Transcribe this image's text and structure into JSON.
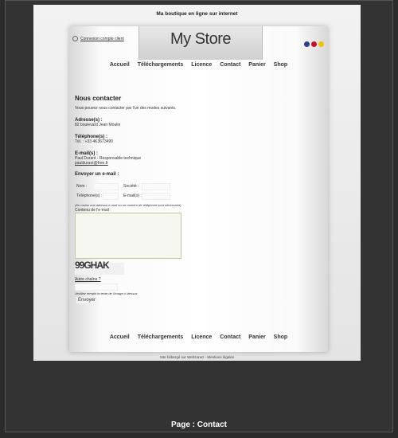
{
  "tagline": "Ma boutique en ligne sur internet",
  "logo": "My Store",
  "account_link": "Connexion compte client",
  "flags": [
    "#2b3f8c",
    "#c8102e",
    "#f4c300"
  ],
  "nav": [
    "Accueil",
    "Téléchargements",
    "Licence",
    "Contact",
    "Panier",
    "Shop"
  ],
  "content": {
    "title": "Nous contacter",
    "intro": "Vous pouvez nous contacter par l'un des modes suivants.",
    "address_title": "Adresse(s) :",
    "address": "82 boulevard Jean Moulin",
    "phone_title": "Téléphone(s) :",
    "phone": "Tél. : +33 4K3673490",
    "email_title": "E-mail(s) :",
    "email_person": "Paul Durant - Responsable technique",
    "email_addr": "pauldurant@free.fr",
    "send_title": "Envoyer un e-mail :",
    "labels": {
      "nom": "Nom :",
      "societe": "Société :",
      "telephone": "Téléphone(s) :",
      "email": "E-mail(s) :"
    },
    "note": "(Au moins une adresse e-mail ou un numéro de téléphone sont nécessaire)",
    "message_label": "Contenu de l'e-mail :",
    "captcha_text": "99GHAK",
    "captcha_link": "Autre chaîne ?",
    "captcha_help": "Veuillez remplir le texte de l'image ci-dessus",
    "send_button": "Envoyer"
  },
  "footer": "Site hébergé sur Webzonez - Mentions légales",
  "caption": "Page : Contact"
}
